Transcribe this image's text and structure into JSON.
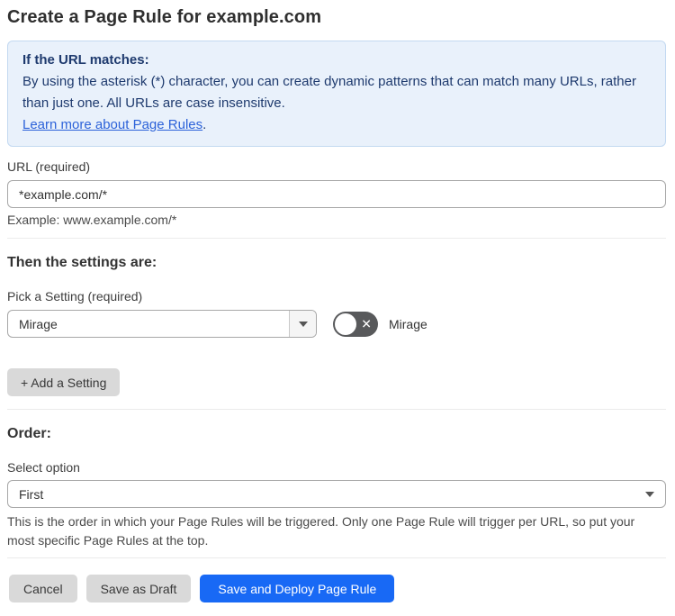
{
  "page": {
    "title": "Create a Page Rule for example.com"
  },
  "info_box": {
    "heading": "If the URL matches:",
    "body": "By using the asterisk (*) character, you can create dynamic patterns that can match many URLs, rather than just one. All URLs are case insensitive.",
    "link_label": "Learn more about Page Rules",
    "link_suffix": "."
  },
  "url_field": {
    "label": "URL (required)",
    "value": "*example.com/*",
    "helper": "Example: www.example.com/*"
  },
  "settings_section": {
    "heading": "Then the settings are:",
    "picker_label": "Pick a Setting (required)",
    "picker_value": "Mirage",
    "toggle_state": "off",
    "toggle_glyph": "✕",
    "toggle_label": "Mirage",
    "add_button_label": "+ Add a Setting"
  },
  "order_section": {
    "heading": "Order:",
    "select_label": "Select option",
    "select_value": "First",
    "helper": "This is the order in which your Page Rules will be triggered. Only one Page Rule will trigger per URL, so put your most specific Page Rules at the top."
  },
  "footer": {
    "cancel_label": "Cancel",
    "save_draft_label": "Save as Draft",
    "save_deploy_label": "Save and Deploy Page Rule"
  },
  "colors": {
    "info_bg": "#e9f1fb",
    "info_border": "#c3d9f1",
    "info_text": "#1e3a6e",
    "link": "#2c62d9",
    "primary_button": "#1869f5",
    "gray_button": "#d9d9d9",
    "toggle_off": "#58595b"
  }
}
